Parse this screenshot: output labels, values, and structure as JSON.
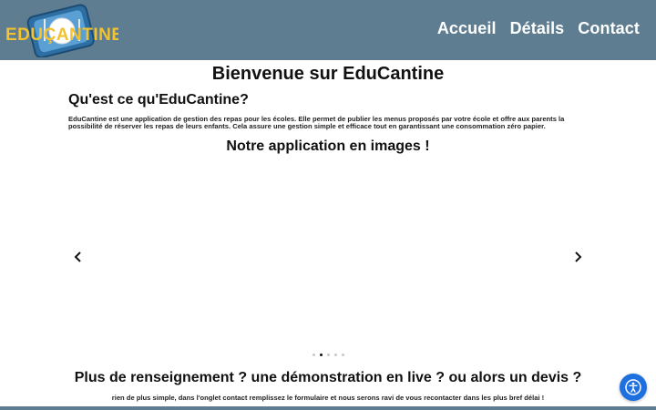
{
  "header": {
    "logo_text": "EDUCANTINE",
    "nav": [
      {
        "label": "Accueil"
      },
      {
        "label": "Détails"
      },
      {
        "label": "Contact"
      }
    ]
  },
  "main": {
    "title": "Bienvenue sur EduCantine",
    "about_title": "Qu'est ce qu'EduCantine?",
    "about_text": "EduCantine est une application de gestion des repas pour les écoles. Elle permet de publier les menus proposés par votre école et offre aux parents la possibilité de réserver les repas de leurs enfants. Cela assure une gestion simple et efficace tout en garantissant une consommation zéro papier.",
    "images_title": "Notre application en images !",
    "carousel": {
      "prev_icon": "chevron-left-icon",
      "next_icon": "chevron-right-icon",
      "slide_count": 5,
      "active_slide": 2
    },
    "cta_title": "Plus de renseignement ? une démonstration en live ? ou alors un devis ?",
    "cta_text": "rien de plus simple, dans l'onglet contact remplissez le formulaire et nous serons ravi de vous recontacter dans les plus bref délai !"
  },
  "accessibility": {
    "icon": "accessibility-icon"
  },
  "colors": {
    "header_bg": "#5f7d90",
    "logo_yellow": "#f2c230",
    "logo_blue": "#2e6fa3",
    "a11y_blue": "#1e6fe0"
  }
}
